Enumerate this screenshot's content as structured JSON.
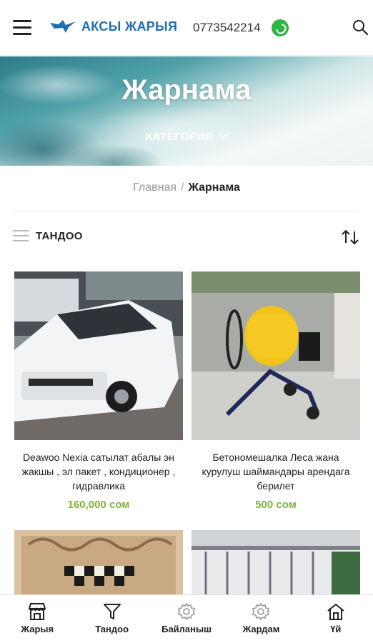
{
  "header": {
    "logo_text": "АКСЫ ЖАРЫЯ",
    "phone": "0773542214",
    "brand_color": "#1e6fb5",
    "whatsapp_color": "#2fb543"
  },
  "hero": {
    "title": "Жарнама",
    "category_label": "КАТЕГОРИЯ"
  },
  "breadcrumb": {
    "home": "Главная",
    "separator": "/",
    "current": "Жарнама"
  },
  "sort": {
    "label": "ТАНДОО"
  },
  "products": [
    {
      "title": "Deawoo Nexia сатылат абалы эн жакшы , эл пакет , кондиционер , гидравлика",
      "price": "160,000 сом",
      "image": "white-car-photo"
    },
    {
      "title": "Бетономешалка Леса жана курулуш шаймандары арендага берилет",
      "price": "500 сом",
      "image": "cement-mixer-photo"
    },
    {
      "title": "",
      "price": "",
      "image": "carved-chess-board-photo"
    },
    {
      "title": "",
      "price": "",
      "image": "metal-fence-photo"
    }
  ],
  "price_color": "#7fb239",
  "bottom_nav": [
    {
      "label": "Жарыя",
      "icon": "shop-icon"
    },
    {
      "label": "Тандоо",
      "icon": "filter-icon"
    },
    {
      "label": "Байланыш",
      "icon": "gear-icon"
    },
    {
      "label": "Жардам",
      "icon": "gear-icon"
    },
    {
      "label": "Үй",
      "icon": "home-icon"
    }
  ]
}
